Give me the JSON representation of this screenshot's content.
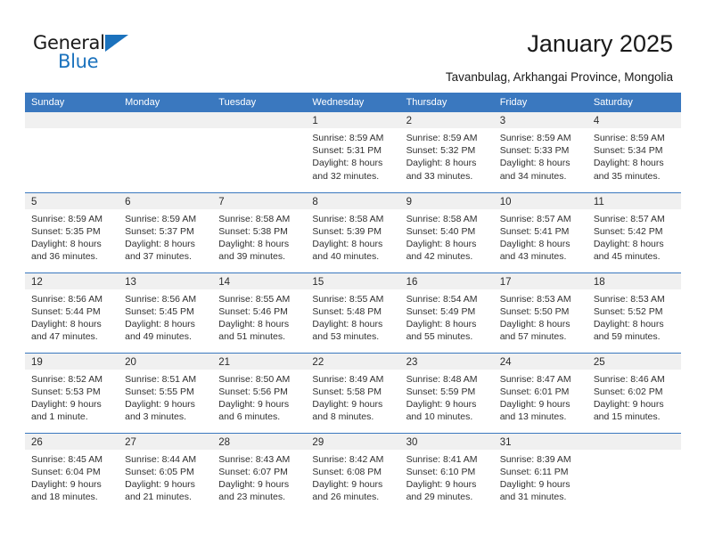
{
  "brand": {
    "name_top": "General",
    "name_bottom": "Blue",
    "accent_color": "#1b72bd"
  },
  "header": {
    "title": "January 2025",
    "subtitle": "Tavanbulag, Arkhangai Province, Mongolia"
  },
  "calendar": {
    "header_bg": "#3a78bf",
    "daynum_bg": "#f0f0f0",
    "weekday_headers": [
      "Sunday",
      "Monday",
      "Tuesday",
      "Wednesday",
      "Thursday",
      "Friday",
      "Saturday"
    ],
    "weeks": [
      [
        {
          "day": "",
          "lines": []
        },
        {
          "day": "",
          "lines": []
        },
        {
          "day": "",
          "lines": []
        },
        {
          "day": "1",
          "lines": [
            "Sunrise: 8:59 AM",
            "Sunset: 5:31 PM",
            "Daylight: 8 hours",
            "and 32 minutes."
          ]
        },
        {
          "day": "2",
          "lines": [
            "Sunrise: 8:59 AM",
            "Sunset: 5:32 PM",
            "Daylight: 8 hours",
            "and 33 minutes."
          ]
        },
        {
          "day": "3",
          "lines": [
            "Sunrise: 8:59 AM",
            "Sunset: 5:33 PM",
            "Daylight: 8 hours",
            "and 34 minutes."
          ]
        },
        {
          "day": "4",
          "lines": [
            "Sunrise: 8:59 AM",
            "Sunset: 5:34 PM",
            "Daylight: 8 hours",
            "and 35 minutes."
          ]
        }
      ],
      [
        {
          "day": "5",
          "lines": [
            "Sunrise: 8:59 AM",
            "Sunset: 5:35 PM",
            "Daylight: 8 hours",
            "and 36 minutes."
          ]
        },
        {
          "day": "6",
          "lines": [
            "Sunrise: 8:59 AM",
            "Sunset: 5:37 PM",
            "Daylight: 8 hours",
            "and 37 minutes."
          ]
        },
        {
          "day": "7",
          "lines": [
            "Sunrise: 8:58 AM",
            "Sunset: 5:38 PM",
            "Daylight: 8 hours",
            "and 39 minutes."
          ]
        },
        {
          "day": "8",
          "lines": [
            "Sunrise: 8:58 AM",
            "Sunset: 5:39 PM",
            "Daylight: 8 hours",
            "and 40 minutes."
          ]
        },
        {
          "day": "9",
          "lines": [
            "Sunrise: 8:58 AM",
            "Sunset: 5:40 PM",
            "Daylight: 8 hours",
            "and 42 minutes."
          ]
        },
        {
          "day": "10",
          "lines": [
            "Sunrise: 8:57 AM",
            "Sunset: 5:41 PM",
            "Daylight: 8 hours",
            "and 43 minutes."
          ]
        },
        {
          "day": "11",
          "lines": [
            "Sunrise: 8:57 AM",
            "Sunset: 5:42 PM",
            "Daylight: 8 hours",
            "and 45 minutes."
          ]
        }
      ],
      [
        {
          "day": "12",
          "lines": [
            "Sunrise: 8:56 AM",
            "Sunset: 5:44 PM",
            "Daylight: 8 hours",
            "and 47 minutes."
          ]
        },
        {
          "day": "13",
          "lines": [
            "Sunrise: 8:56 AM",
            "Sunset: 5:45 PM",
            "Daylight: 8 hours",
            "and 49 minutes."
          ]
        },
        {
          "day": "14",
          "lines": [
            "Sunrise: 8:55 AM",
            "Sunset: 5:46 PM",
            "Daylight: 8 hours",
            "and 51 minutes."
          ]
        },
        {
          "day": "15",
          "lines": [
            "Sunrise: 8:55 AM",
            "Sunset: 5:48 PM",
            "Daylight: 8 hours",
            "and 53 minutes."
          ]
        },
        {
          "day": "16",
          "lines": [
            "Sunrise: 8:54 AM",
            "Sunset: 5:49 PM",
            "Daylight: 8 hours",
            "and 55 minutes."
          ]
        },
        {
          "day": "17",
          "lines": [
            "Sunrise: 8:53 AM",
            "Sunset: 5:50 PM",
            "Daylight: 8 hours",
            "and 57 minutes."
          ]
        },
        {
          "day": "18",
          "lines": [
            "Sunrise: 8:53 AM",
            "Sunset: 5:52 PM",
            "Daylight: 8 hours",
            "and 59 minutes."
          ]
        }
      ],
      [
        {
          "day": "19",
          "lines": [
            "Sunrise: 8:52 AM",
            "Sunset: 5:53 PM",
            "Daylight: 9 hours",
            "and 1 minute."
          ]
        },
        {
          "day": "20",
          "lines": [
            "Sunrise: 8:51 AM",
            "Sunset: 5:55 PM",
            "Daylight: 9 hours",
            "and 3 minutes."
          ]
        },
        {
          "day": "21",
          "lines": [
            "Sunrise: 8:50 AM",
            "Sunset: 5:56 PM",
            "Daylight: 9 hours",
            "and 6 minutes."
          ]
        },
        {
          "day": "22",
          "lines": [
            "Sunrise: 8:49 AM",
            "Sunset: 5:58 PM",
            "Daylight: 9 hours",
            "and 8 minutes."
          ]
        },
        {
          "day": "23",
          "lines": [
            "Sunrise: 8:48 AM",
            "Sunset: 5:59 PM",
            "Daylight: 9 hours",
            "and 10 minutes."
          ]
        },
        {
          "day": "24",
          "lines": [
            "Sunrise: 8:47 AM",
            "Sunset: 6:01 PM",
            "Daylight: 9 hours",
            "and 13 minutes."
          ]
        },
        {
          "day": "25",
          "lines": [
            "Sunrise: 8:46 AM",
            "Sunset: 6:02 PM",
            "Daylight: 9 hours",
            "and 15 minutes."
          ]
        }
      ],
      [
        {
          "day": "26",
          "lines": [
            "Sunrise: 8:45 AM",
            "Sunset: 6:04 PM",
            "Daylight: 9 hours",
            "and 18 minutes."
          ]
        },
        {
          "day": "27",
          "lines": [
            "Sunrise: 8:44 AM",
            "Sunset: 6:05 PM",
            "Daylight: 9 hours",
            "and 21 minutes."
          ]
        },
        {
          "day": "28",
          "lines": [
            "Sunrise: 8:43 AM",
            "Sunset: 6:07 PM",
            "Daylight: 9 hours",
            "and 23 minutes."
          ]
        },
        {
          "day": "29",
          "lines": [
            "Sunrise: 8:42 AM",
            "Sunset: 6:08 PM",
            "Daylight: 9 hours",
            "and 26 minutes."
          ]
        },
        {
          "day": "30",
          "lines": [
            "Sunrise: 8:41 AM",
            "Sunset: 6:10 PM",
            "Daylight: 9 hours",
            "and 29 minutes."
          ]
        },
        {
          "day": "31",
          "lines": [
            "Sunrise: 8:39 AM",
            "Sunset: 6:11 PM",
            "Daylight: 9 hours",
            "and 31 minutes."
          ]
        },
        {
          "day": "",
          "lines": []
        }
      ]
    ]
  }
}
